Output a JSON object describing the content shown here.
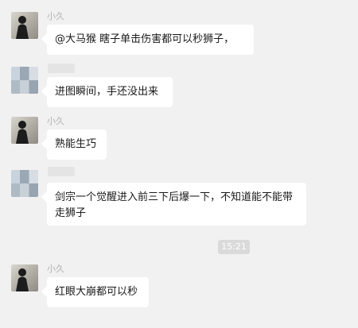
{
  "messages": [
    {
      "sender": "小久",
      "text": "@大马猴 瞎子单击伤害都可以秒狮子，"
    },
    {
      "sender": "",
      "text": "进图瞬间，手还没出来"
    },
    {
      "sender": "小久",
      "text": "熟能生巧"
    },
    {
      "sender": "",
      "text": "剑宗一个觉醒进入前三下后爆一下，不知道能不能带走狮子"
    },
    {
      "sender": "小久",
      "text": "红眼大崩都可以秒"
    }
  ],
  "timestamp": "15:21",
  "colors": {
    "background": "#f1f1f1",
    "bubble": "#ffffff",
    "sender_text": "#b2b2b2"
  }
}
